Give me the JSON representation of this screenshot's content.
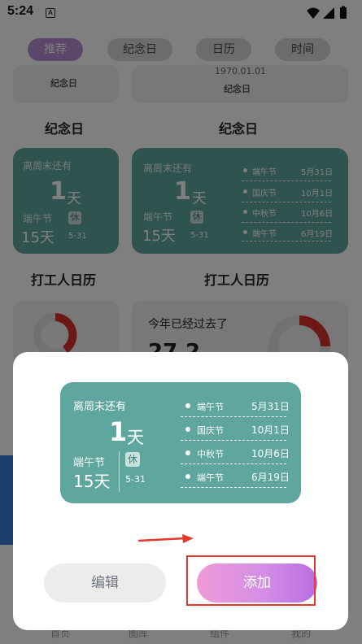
{
  "status_bar": {
    "time": "5:24",
    "app_icon_letter": "A"
  },
  "tabs": [
    {
      "label": "推荐",
      "active": true
    },
    {
      "label": "纪念日",
      "active": false
    },
    {
      "label": "日历",
      "active": false
    },
    {
      "label": "时间",
      "active": false
    }
  ],
  "background": {
    "card_left_caption": "纪念日",
    "card_right_date": "1970.01.01",
    "card_right_caption": "纪念日",
    "section_left": "纪念日",
    "section_right": "纪念日",
    "section_calendar_left": "打工人日历",
    "section_calendar_right": "打工人日历",
    "year_progress_title": "今年已经过去了",
    "year_progress_partial": "27.2"
  },
  "countdown_card": {
    "title": "离周末还有",
    "days_number": "1",
    "days_unit": "天",
    "holiday_name": "端午节",
    "holiday_days": "15天",
    "rest_badge": "休",
    "holiday_date": "5-31",
    "holidays": [
      {
        "name": "端午节",
        "date": "5月31日"
      },
      {
        "name": "国庆节",
        "date": "10月1日"
      },
      {
        "name": "中秋节",
        "date": "10月6日"
      },
      {
        "name": "端午节",
        "date": "6月19日"
      }
    ]
  },
  "dialog": {
    "edit_label": "编辑",
    "add_label": "添加"
  },
  "bottom_nav": [
    "首页",
    "图库",
    "组件",
    "我的"
  ],
  "colors": {
    "teal": "#5ea69e",
    "accent_purple": "#b98fd6",
    "highlight_red": "#e2392f",
    "progress_red": "#d9302b"
  }
}
